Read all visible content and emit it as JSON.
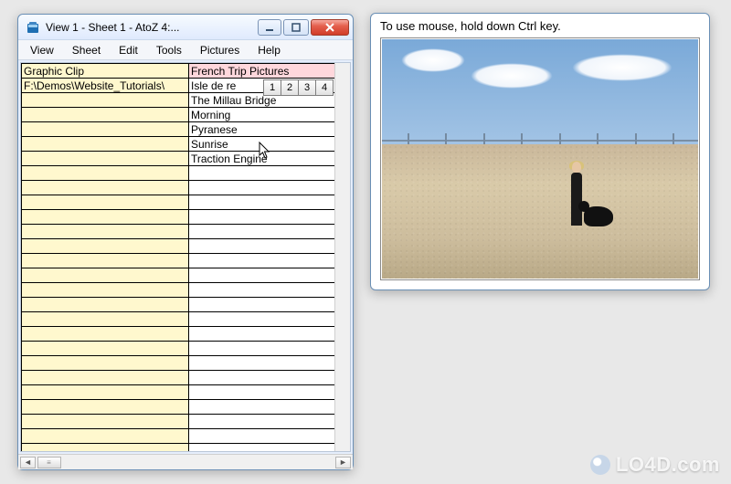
{
  "mainWindow": {
    "title": "View 1  -   Sheet 1   -   AtoZ           4:...",
    "menus": [
      "View",
      "Sheet",
      "Edit",
      "Tools",
      "Pictures",
      "Help"
    ],
    "tabs": [
      "1",
      "2",
      "3",
      "4"
    ],
    "colA": [
      "Graphic Clip",
      "F:\\Demos\\Website_Tutorials\\"
    ],
    "colB": [
      "French Trip Pictures",
      "Isle de re",
      "The Millau Bridge",
      "Morning",
      "Pyranese",
      "Sunrise",
      "Traction Engine"
    ],
    "selectedRow": 0,
    "totalVisibleRows": 27
  },
  "previewWindow": {
    "hint": "To use mouse, hold down Ctrl key."
  },
  "watermark": "LO4D.com"
}
